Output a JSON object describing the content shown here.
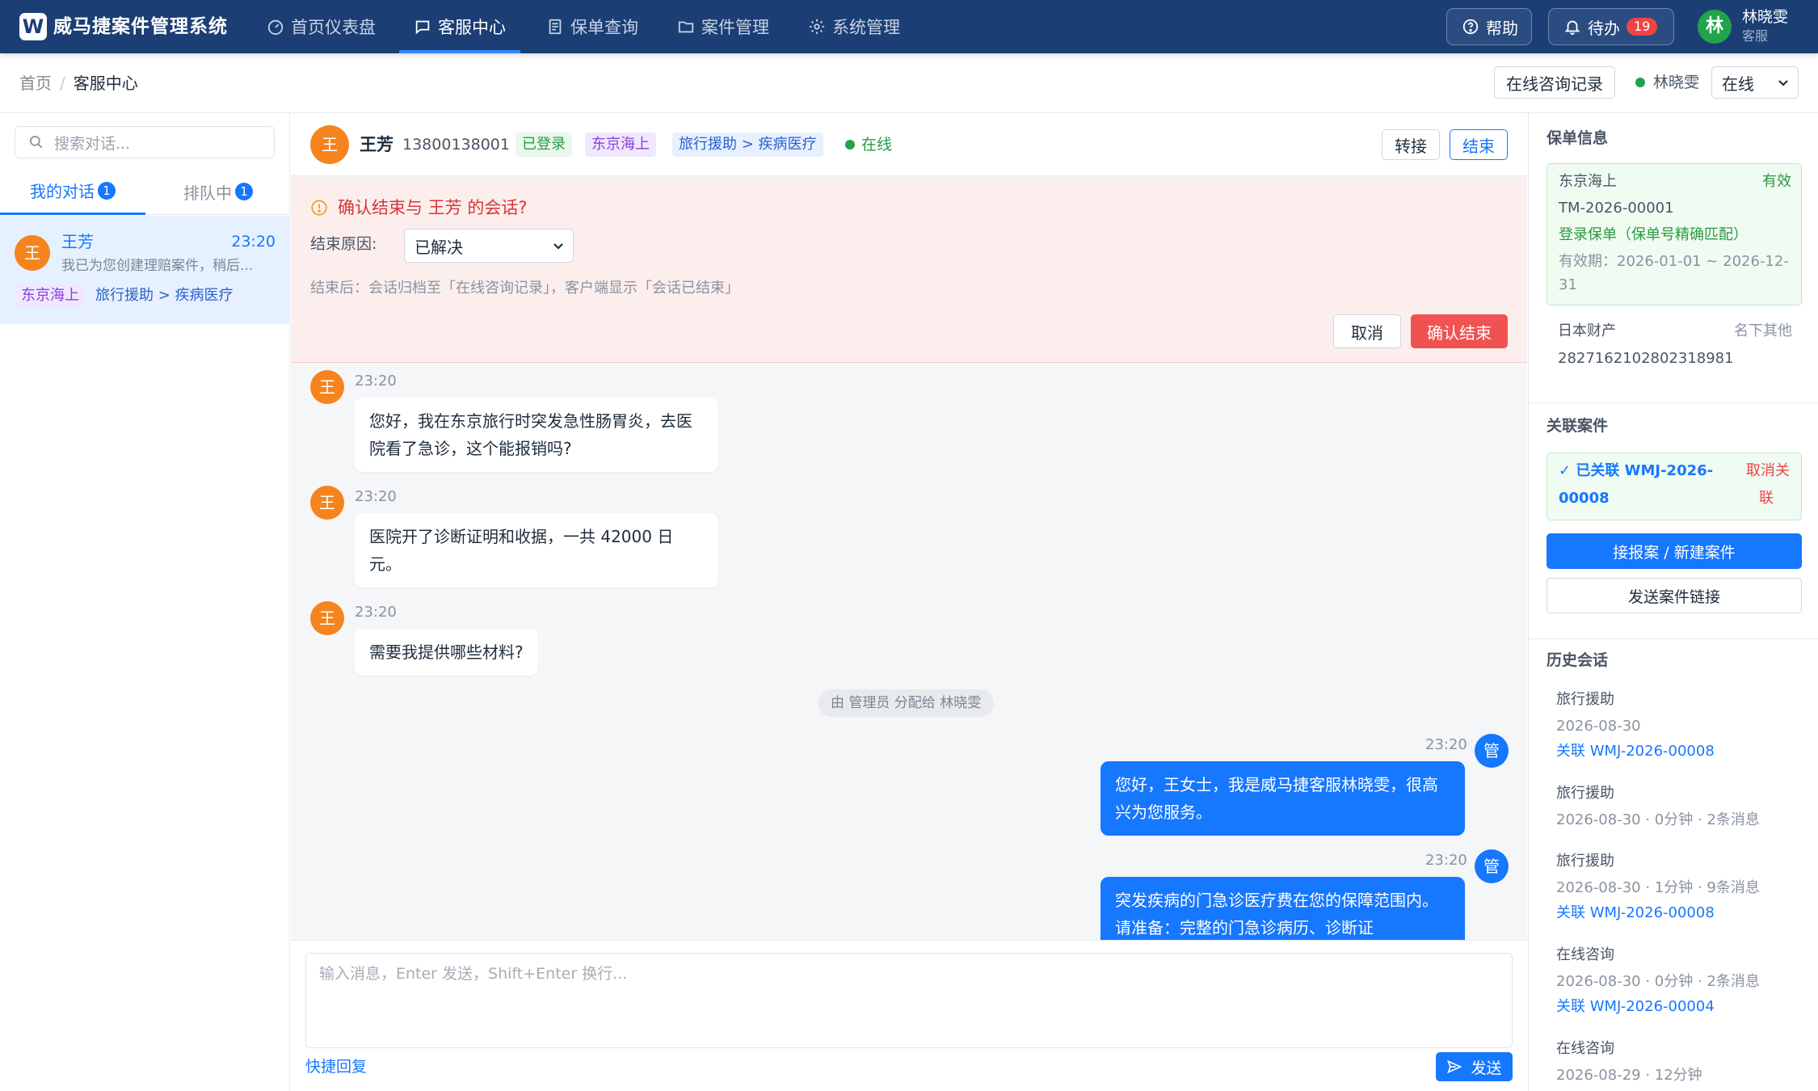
{
  "nav": {
    "logo": "W",
    "brand": "威马捷案件管理系统",
    "items": [
      "首页仪表盘",
      "客服中心",
      "保单查询",
      "案件管理",
      "系统管理"
    ],
    "active_index": 1,
    "help": "帮助",
    "todo": "待办",
    "todo_count": "19",
    "user_initial": "林",
    "user_name": "林晓雯",
    "user_role": "客服"
  },
  "breadcrumb": {
    "home": "首页",
    "sep": "/",
    "current": "客服中心",
    "records_button": "在线咨询记录",
    "agent_name": "林晓雯",
    "status_value": "在线"
  },
  "left": {
    "search_placeholder": "搜索对话...",
    "tabs": [
      {
        "label": "我的对话",
        "count": "1"
      },
      {
        "label": "排队中",
        "count": "1"
      }
    ],
    "conversation": {
      "initial": "王",
      "name": "王芳",
      "time": "23:20",
      "preview": "我已为您创建理赔案件，稍后...",
      "tags": [
        "东京海上",
        "旅行援助 > 疾病医疗"
      ]
    }
  },
  "chat": {
    "header": {
      "initial": "王",
      "name": "王芳",
      "phone": "13800138001",
      "tags": [
        "已登录",
        "东京海上",
        "旅行援助 > 疾病医疗"
      ],
      "online": "在线",
      "transfer": "转接",
      "end": "结束"
    },
    "confirm": {
      "title": "确认结束与 王芳 的会话?",
      "reason_label": "结束原因:",
      "reason_value": "已解决",
      "hint": "结束后：会话归档至「在线咨询记录」，客户端显示「会话已结束」",
      "cancel": "取消",
      "confirm": "确认结束"
    },
    "messages": [
      {
        "initial": "王",
        "time": "23:20",
        "text": "您好，我在东京旅行时突发急性肠胃炎，去医院看了急诊，这个能报销吗?"
      },
      {
        "initial": "王",
        "time": "23:20",
        "text": "医院开了诊断证明和收据，一共 42000 日元。"
      },
      {
        "initial": "王",
        "time": "23:20",
        "text": "需要我提供哪些材料?"
      },
      {
        "initial": "管",
        "time": "23:20",
        "text": "您好，王女士，我是威马捷客服林晓雯，很高兴为您服务。"
      },
      {
        "initial": "管",
        "time": "23:20",
        "text": "突发疾病的门急诊医疗费在您的保障范围内。请准备：完整的门急诊病历、诊断证"
      }
    ],
    "system_message": "由 管理员 分配给 林晓雯",
    "input_placeholder": "输入消息，Enter 发送，Shift+Enter 换行...",
    "quick_reply": "快捷回复",
    "send": "发送"
  },
  "right": {
    "policy_title": "保单信息",
    "policy": {
      "company": "东京海上",
      "status": "有效",
      "number": "TM-2026-00001",
      "match": "登录保单（保单号精确匹配）",
      "validity_line1": "有效期：2026-01-01 ~ 2026-12-",
      "validity_line2": "31"
    },
    "other_policy": {
      "company": "日本财产",
      "note": "名下其他",
      "number": "2827162102802318981"
    },
    "linked_title": "关联案件",
    "linked": {
      "line1": "✓ 已关联 WMJ-2026-",
      "line2": "00008",
      "unlink1": "取消关",
      "unlink2": "联"
    },
    "new_case": "接报案 / 新建案件",
    "send_link": "发送案件链接",
    "history_title": "历史会话",
    "history": [
      {
        "type": "旅行援助",
        "meta": "2026-08-30",
        "link": "关联 WMJ-2026-00008"
      },
      {
        "type": "旅行援助",
        "meta": "2026-08-30 · 0分钟 · 2条消息",
        "link": ""
      },
      {
        "type": "旅行援助",
        "meta": "2026-08-30 · 1分钟 · 9条消息",
        "link": "关联 WMJ-2026-00008"
      },
      {
        "type": "在线咨询",
        "meta": "2026-08-30 · 0分钟 · 2条消息",
        "link": "关联 WMJ-2026-00004"
      },
      {
        "type": "在线咨询",
        "meta": "2026-08-29 · 12分钟",
        "link": ""
      }
    ]
  },
  "colors": {
    "nav_bg": "#1b3e74",
    "primary": "#1677ff",
    "danger": "#ef4444",
    "success": "#22a34a",
    "customer_avatar": "#f5841f"
  },
  "icons": {
    "dashboard": "gauge-icon",
    "service": "chat-icon",
    "policy": "document-icon",
    "cases": "folder-icon",
    "settings": "gear-icon",
    "help": "question-icon",
    "todo": "bell-icon",
    "search": "search-icon",
    "warning": "warning-icon",
    "send": "send-icon"
  }
}
